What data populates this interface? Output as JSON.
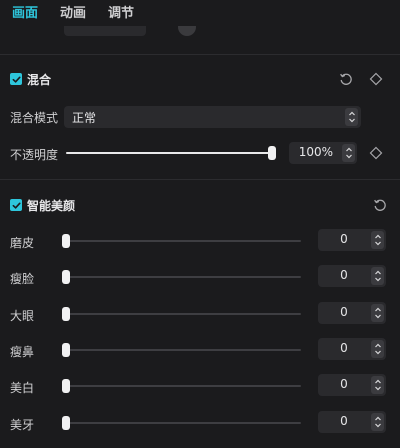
{
  "tabs": [
    {
      "label": "画面"
    },
    {
      "label": "动画"
    },
    {
      "label": "调节"
    }
  ],
  "blend": {
    "title": "混合",
    "mode_label": "混合模式",
    "mode_value": "正常",
    "opacity_label": "不透明度",
    "opacity_value": "100%",
    "opacity_level": 1.0
  },
  "beauty": {
    "title": "智能美颜",
    "sliders": [
      {
        "label": "磨皮",
        "value": "0",
        "level": 0.0
      },
      {
        "label": "瘦脸",
        "value": "0",
        "level": 0.0
      },
      {
        "label": "大眼",
        "value": "0",
        "level": 0.0
      },
      {
        "label": "瘦鼻",
        "value": "0",
        "level": 0.0
      },
      {
        "label": "美白",
        "value": "0",
        "level": 0.0
      },
      {
        "label": "美牙",
        "value": "0",
        "level": 0.0
      }
    ]
  },
  "colors": {
    "accent": "#2ec6dc",
    "background": "#1b1b1d",
    "control": "#2a2a2d"
  },
  "icons": {
    "reset": "reset-icon",
    "keyframe": "keyframe-diamond-icon",
    "check": "checkbox-check-icon",
    "stepper": "stepper-arrows-icon"
  }
}
